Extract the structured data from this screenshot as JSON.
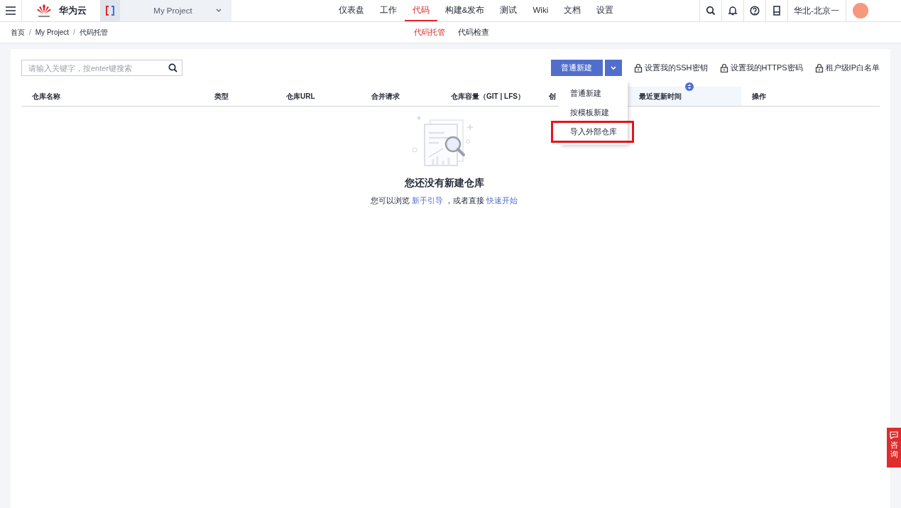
{
  "header": {
    "brand": "华为云",
    "project": "My Project",
    "nav": [
      {
        "label": "仪表盘",
        "selected": false
      },
      {
        "label": "工作",
        "selected": false
      },
      {
        "label": "代码",
        "selected": true
      },
      {
        "label": "构建&发布",
        "selected": false
      },
      {
        "label": "测试",
        "selected": false
      },
      {
        "label": "Wiki",
        "selected": false
      },
      {
        "label": "文档",
        "selected": false
      },
      {
        "label": "设置",
        "selected": false
      }
    ],
    "region": "华北-北京一"
  },
  "breadcrumb": [
    {
      "kind": "link",
      "text": "首页"
    },
    {
      "kind": "separator",
      "text": "/"
    },
    {
      "kind": "link",
      "text": "My Project"
    },
    {
      "kind": "separator",
      "text": "/"
    },
    {
      "kind": "current",
      "text": "代码托管"
    }
  ],
  "subtabs": [
    {
      "label": "代码托管",
      "selected": true
    },
    {
      "label": "代码检查",
      "selected": false
    }
  ],
  "toolbar": {
    "search": {
      "placeholder": "请输入关键字，按enter键搜索"
    },
    "new_button": "普通新建",
    "links": [
      "设置我的SSH密钥",
      "设置我的HTTPS密码",
      "租户级IP白名单"
    ]
  },
  "dropdown": {
    "items": [
      {
        "label": "普通新建",
        "highlighted": false
      },
      {
        "label": "按模板新建",
        "highlighted": false
      },
      {
        "label": "导入外部仓库",
        "highlighted": true
      }
    ]
  },
  "table": {
    "columns": [
      {
        "label": "仓库名称",
        "sorted": false
      },
      {
        "label": "类型",
        "sorted": false
      },
      {
        "label": "仓库URL",
        "sorted": false
      },
      {
        "label": "合并请求",
        "sorted": false
      },
      {
        "label": "仓库容量（GIT | LFS）",
        "sorted": false
      },
      {
        "label": "创",
        "sorted": false
      },
      {
        "label": "最近更新时间",
        "sorted": true
      },
      {
        "label": "操作",
        "sorted": false
      }
    ]
  },
  "empty": {
    "title": "您还没有新建仓库",
    "sentence": [
      {
        "kind": "text",
        "text": "您可以浏览 "
      },
      {
        "kind": "link",
        "text": "新手引导"
      },
      {
        "kind": "text",
        "text": " ，或者直接 "
      },
      {
        "kind": "link",
        "text": "快速开始"
      }
    ]
  },
  "consult": "咨询"
}
